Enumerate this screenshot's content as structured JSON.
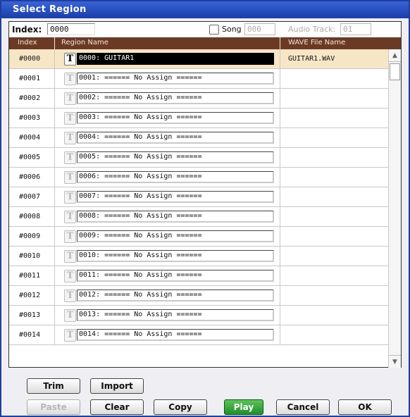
{
  "dialog": {
    "title": "Select Region"
  },
  "index": {
    "label": "Index:",
    "value": "0000"
  },
  "song": {
    "label": "Song",
    "value": "000",
    "checked": false
  },
  "audio_track": {
    "label": "Audio Track:",
    "value": "01"
  },
  "columns": {
    "index": "Index",
    "region_name": "Region Name",
    "wave_file": "WAVE File Name"
  },
  "t_icon_glyph": "T",
  "rows": [
    {
      "index": "#0000",
      "name": "0000: GUITAR1",
      "wave": "GUITAR1.WAV"
    },
    {
      "index": "#0001",
      "name": "0001: ====== No Assign ======",
      "wave": ""
    },
    {
      "index": "#0002",
      "name": "0002: ====== No Assign ======",
      "wave": ""
    },
    {
      "index": "#0003",
      "name": "0003: ====== No Assign ======",
      "wave": ""
    },
    {
      "index": "#0004",
      "name": "0004: ====== No Assign ======",
      "wave": ""
    },
    {
      "index": "#0005",
      "name": "0005: ====== No Assign ======",
      "wave": ""
    },
    {
      "index": "#0006",
      "name": "0006: ====== No Assign ======",
      "wave": ""
    },
    {
      "index": "#0007",
      "name": "0007: ====== No Assign ======",
      "wave": ""
    },
    {
      "index": "#0008",
      "name": "0008: ====== No Assign ======",
      "wave": ""
    },
    {
      "index": "#0009",
      "name": "0009: ====== No Assign ======",
      "wave": ""
    },
    {
      "index": "#0010",
      "name": "0010: ====== No Assign ======",
      "wave": ""
    },
    {
      "index": "#0011",
      "name": "0011: ====== No Assign ======",
      "wave": ""
    },
    {
      "index": "#0012",
      "name": "0012: ====== No Assign ======",
      "wave": ""
    },
    {
      "index": "#0013",
      "name": "0013: ====== No Assign ======",
      "wave": ""
    },
    {
      "index": "#0014",
      "name": "0014: ====== No Assign ======",
      "wave": ""
    }
  ],
  "scroll": {
    "up_glyph": "▲",
    "down_glyph": "▼"
  },
  "buttons": {
    "trim": "Trim",
    "import": "Import",
    "paste": "Paste",
    "clear": "Clear",
    "copy": "Copy",
    "play": "Play",
    "cancel": "Cancel",
    "ok": "OK"
  },
  "colors": {
    "title": "#1a3ea8",
    "header": "#6b3a24",
    "selected_row": "#f7e6c6",
    "play": "#1f8f2a"
  }
}
